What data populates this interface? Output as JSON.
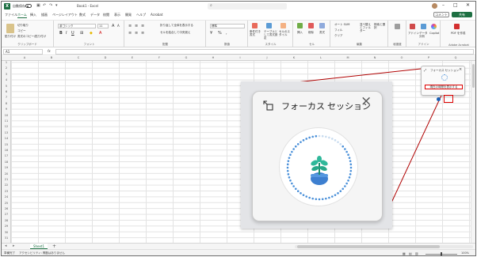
{
  "titlebar": {
    "autosave_label": "自動保存",
    "autosave_state": "オフ",
    "doc_title": "Book1 - Excel",
    "search_placeholder": "検索"
  },
  "tabs": [
    "ファイル",
    "ホーム",
    "挿入",
    "描画",
    "ページレイアウト",
    "数式",
    "データ",
    "校閲",
    "表示",
    "開発",
    "ヘルプ",
    "Acrobat"
  ],
  "active_tab": "ホーム",
  "actions": {
    "comment_label": "コメント",
    "share_label": "共有"
  },
  "ribbon": {
    "clipboard": {
      "label": "クリップボード",
      "paste": "貼り付け",
      "cut": "切り取り",
      "copy": "コピー",
      "format_painter": "書式のコピー/貼り付け"
    },
    "font": {
      "label": "フォント",
      "font_name": "游ゴシック",
      "font_size": "11"
    },
    "alignment": {
      "label": "配置",
      "wrap": "折り返して全体を表示する",
      "merge": "セルを結合して中央揃え"
    },
    "number": {
      "label": "数値",
      "format": "標準"
    },
    "styles": {
      "label": "スタイル",
      "conditional": "条件付き書式",
      "table": "テーブルとして書式設定",
      "cell_styles": "セルのスタイル"
    },
    "cells": {
      "label": "セル",
      "insert": "挿入",
      "delete": "削除",
      "format": "書式"
    },
    "editing": {
      "label": "編集",
      "autosum": "オート SUM",
      "fill": "フィル",
      "clear": "クリア",
      "sort": "並べ替えとフィルター",
      "find": "検索と選択"
    },
    "sensitivity": {
      "label": "秘度度"
    },
    "addins": {
      "label": "アドイン",
      "addins_btn": "アドイン"
    },
    "analysis": {
      "analyze": "データ分析",
      "copilot": "Copilot"
    },
    "acrobat": {
      "label": "Adobe Acrobat",
      "pdf": "PDF を作成"
    }
  },
  "formula_bar": {
    "cell_ref": "A1",
    "fx": "fx"
  },
  "columns": [
    "A",
    "B",
    "C",
    "D",
    "E",
    "F",
    "G",
    "H",
    "I",
    "J",
    "K",
    "L",
    "M",
    "N",
    "O",
    "P",
    "Q"
  ],
  "rows": [
    "1",
    "2",
    "3",
    "4",
    "5",
    "6",
    "7",
    "8",
    "9",
    "10",
    "11",
    "12",
    "13",
    "14",
    "15",
    "16",
    "17",
    "18",
    "19",
    "20",
    "21",
    "22",
    "23",
    "24",
    "25",
    "26",
    "27",
    "28",
    "29",
    "30",
    "31"
  ],
  "sheet": {
    "name": "Sheet1",
    "add": "+"
  },
  "status": {
    "ready": "準備完了",
    "accessibility": "アクセシビリティ: 問題はありません",
    "zoom": "100%"
  },
  "mini_popup": {
    "title": "フォーカス セッション",
    "input_text": "現在の時間を表示する"
  },
  "focus_panel": {
    "title": "フォーカス セッション",
    "close": "×"
  },
  "colors": {
    "excel_green": "#1d6f42",
    "highlight_red": "#dd0000",
    "plant_leaf": "#2fb89a",
    "pot_blue": "#3d7fd0",
    "dot_blue": "#4a90d9"
  }
}
